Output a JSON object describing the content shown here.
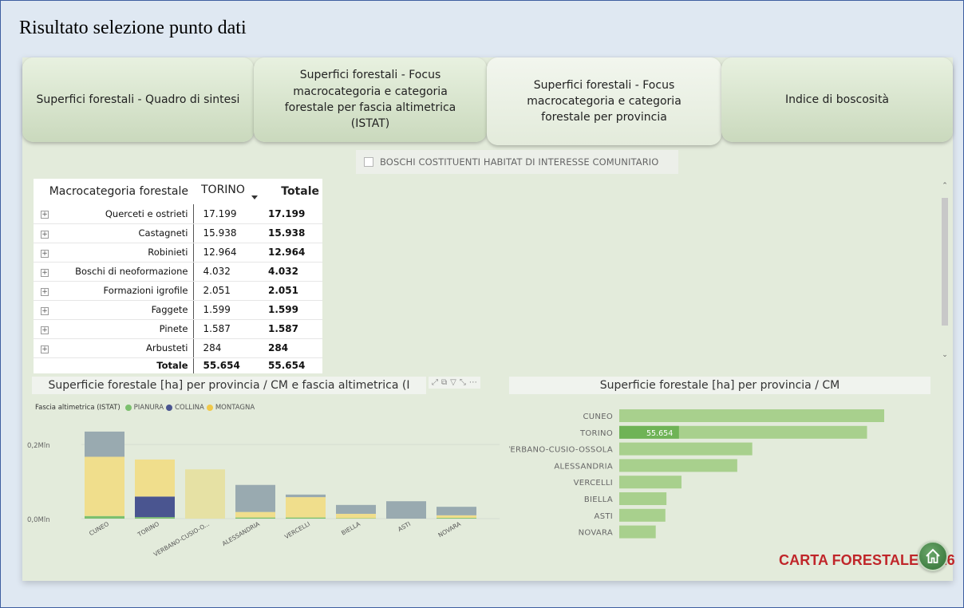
{
  "page_title": "Risultato selezione punto dati",
  "tabs": [
    {
      "label": "Superfici forestali - Quadro di sintesi",
      "active": false
    },
    {
      "label": "Superfici forestali - Focus macrocategoria e categoria forestale per fascia altimetrica (ISTAT)",
      "active": false
    },
    {
      "label": "Superfici forestali - Focus macrocategoria e categoria forestale per provincia",
      "active": true
    },
    {
      "label": "Indice di boscosità",
      "active": false
    }
  ],
  "filter_checkbox": {
    "label": "BOSCHI COSTITUENTI HABITAT DI INTERESSE COMUNITARIO",
    "checked": false
  },
  "matrix": {
    "header_row": "Macrocategoria forestale",
    "header_col": "TORINO",
    "header_total": "Totale",
    "rows": [
      {
        "label": "Querceti e ostrieti",
        "value": "17.199",
        "total": "17.199"
      },
      {
        "label": "Castagneti",
        "value": "15.938",
        "total": "15.938"
      },
      {
        "label": "Robinieti",
        "value": "12.964",
        "total": "12.964"
      },
      {
        "label": "Boschi di neoformazione",
        "value": "4.032",
        "total": "4.032"
      },
      {
        "label": "Formazioni igrofile",
        "value": "2.051",
        "total": "2.051"
      },
      {
        "label": "Faggete",
        "value": "1.599",
        "total": "1.599"
      },
      {
        "label": "Pinete",
        "value": "1.587",
        "total": "1.587"
      },
      {
        "label": "Arbusteti",
        "value": "284",
        "total": "284"
      }
    ],
    "total_label": "Totale",
    "total_value": "55.654",
    "total_total": "55.654",
    "expand_glyph": "+"
  },
  "chart_stacked": {
    "title": "Superficie forestale [ha] per provincia / CM e fascia altimetrica (I",
    "visual_icons": [
      "⤢",
      "⧉",
      "▽",
      "⤡",
      "⋯"
    ],
    "legend_title": "Fascia altimetrica (ISTAT)",
    "chart_data": {
      "type": "bar",
      "stacked": true,
      "categories": [
        "CUNEO",
        "TORINO",
        "VERBANO-CUSIO-O...",
        "ALESSANDRIA",
        "VERCELLI",
        "BIELLA",
        "ASTI",
        "NOVARA"
      ],
      "series": [
        {
          "name": "PIANURA",
          "color": "#7cc06e",
          "values": [
            7000,
            4000,
            0,
            3000,
            3000,
            1000,
            0,
            2000
          ]
        },
        {
          "name": "COLLINA",
          "color": "#4a5590",
          "values": [
            0,
            55654,
            0,
            0,
            0,
            0,
            0,
            0
          ]
        },
        {
          "name": "MONTAGNA",
          "color": "#f0de8c",
          "values": [
            160000,
            100000,
            0,
            15000,
            55000,
            12000,
            0,
            7000
          ]
        },
        {
          "name": "",
          "color": "#99aab0",
          "values": [
            68000,
            0,
            0,
            73000,
            7000,
            24000,
            47000,
            23000
          ]
        },
        {
          "name": "",
          "color": "#e6e1a4",
          "values": [
            0,
            0,
            133000,
            0,
            0,
            0,
            0,
            0
          ]
        }
      ],
      "y_ticks": [
        "0,0Mln",
        "0,2Mln"
      ],
      "ylim": [
        0,
        280000
      ]
    }
  },
  "chart_bar": {
    "title": "Superficie forestale [ha] per provincia / CM",
    "chart_data": {
      "type": "bar",
      "orientation": "horizontal",
      "categories": [
        "CUNEO",
        "TORINO",
        "VERBANO-CUSIO-OSSOLA",
        "ALESSANDRIA",
        "VERCELLI",
        "BIELLA",
        "ASTI",
        "NOVARA"
      ],
      "values": [
        247000,
        231000,
        124000,
        110000,
        58000,
        44000,
        43000,
        34000
      ],
      "highlight": {
        "category": "TORINO",
        "value": 55654,
        "label": "55.654"
      },
      "colors": {
        "bar": "#a8d08d",
        "highlight": "#6fb356"
      }
    }
  },
  "brand": "CARTA FORESTALE 2016",
  "home_icon": "home-icon"
}
